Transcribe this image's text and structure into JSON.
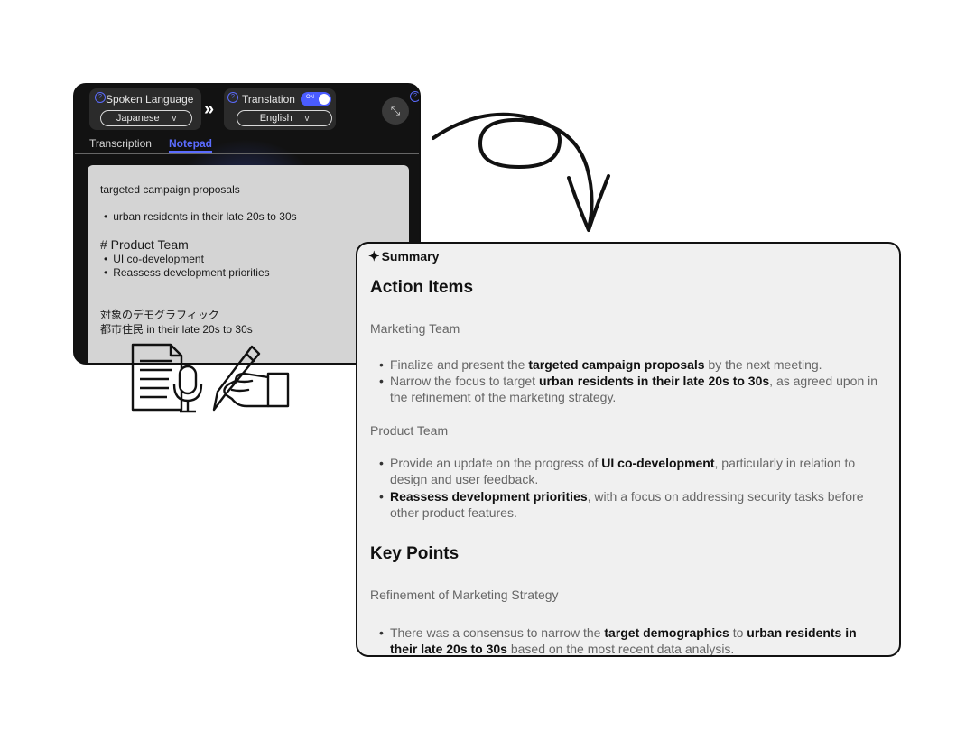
{
  "app": {
    "spoken_language_label": "Spoken Language",
    "spoken_language_value": "Japanese",
    "translation_label": "Translation",
    "translation_toggle": "ON",
    "translation_value": "English",
    "help": "?",
    "chevron": "v",
    "collapse_icon": "⤡",
    "tabs": {
      "transcription": "Transcription",
      "notepad": "Notepad"
    },
    "notepad": {
      "line1": "targeted campaign proposals",
      "line2": "urban residents in their late 20s to 30s",
      "line3": "# Product Team",
      "line4": "UI co-development",
      "line5": "Reassess development priorities",
      "line6": "対象のデモグラフィック",
      "line7": "都市住民 in their late 20s to 30s"
    }
  },
  "summary": {
    "title": "Summary",
    "action_items_heading": "Action Items",
    "marketing_team": "Marketing Team",
    "m_item1": {
      "pre": "Finalize and present the ",
      "bold": "targeted campaign proposals",
      "post": " by the next meeting."
    },
    "m_item2": {
      "pre": "Narrow the focus to target ",
      "bold": "urban residents in their late 20s to 30s",
      "post": ", as agreed upon in the refinement of the marketing strategy."
    },
    "product_team": "Product Team",
    "p_item1": {
      "pre": "Provide an update on the progress of ",
      "bold": "UI co-development",
      "post": ", particularly in relation to design and user feedback."
    },
    "p_item2": {
      "bold": "Reassess development priorities",
      "post": ", with a focus on addressing security tasks before other product features."
    },
    "key_points_heading": "Key Points",
    "refinement": "Refinement of Marketing Strategy",
    "k_item1": {
      "pre": "There was a consensus to narrow the ",
      "bold1": "target demographics",
      "mid": " to ",
      "bold2": "urban residents in their late 20s to 30s",
      "post": " based on the most recent data analysis."
    }
  },
  "icons": {
    "sparkle": "sparkle-icon",
    "arrow": "curly-arrow-icon",
    "doc_mic": "document-microphone-icon",
    "hand_pen": "hand-writing-icon"
  }
}
